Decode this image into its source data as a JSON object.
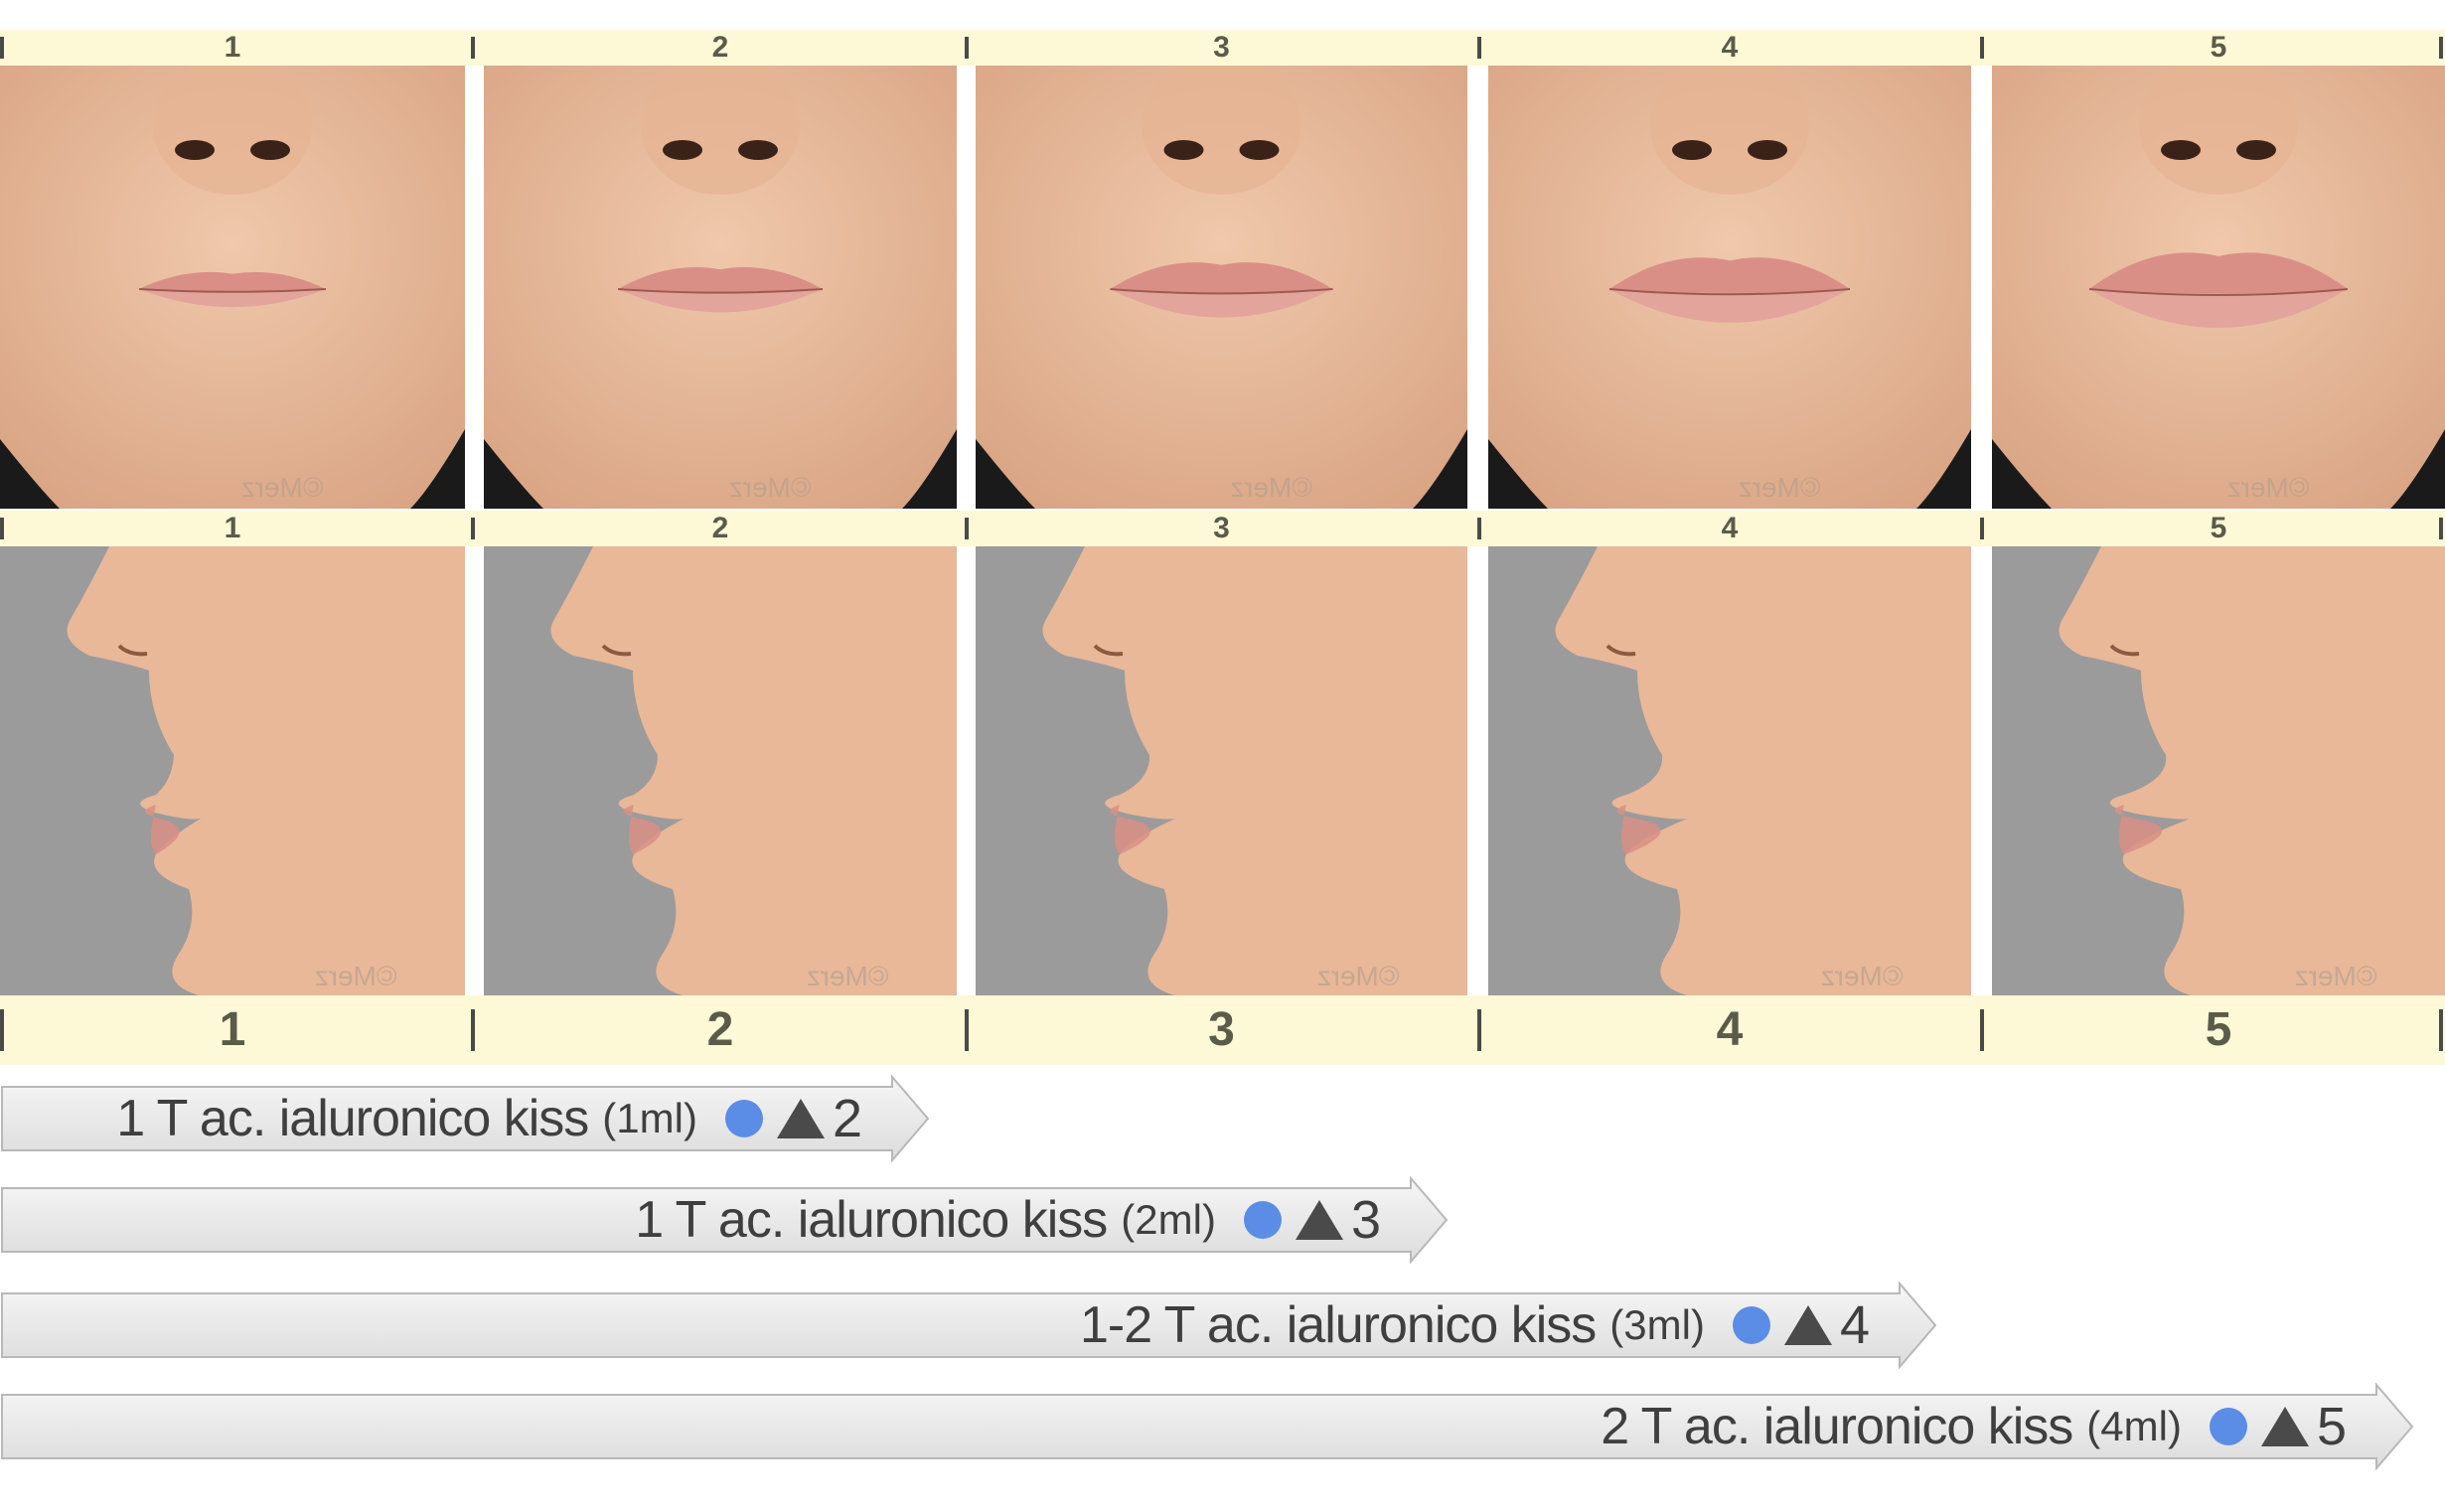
{
  "scale": {
    "top_labels": [
      "1",
      "2",
      "3",
      "4",
      "5"
    ],
    "middle_labels": [
      "1",
      "2",
      "3",
      "4",
      "5"
    ],
    "bottom_labels": [
      "1",
      "2",
      "3",
      "4",
      "5"
    ]
  },
  "photos": {
    "watermark": "©Merz",
    "front_views": [
      {
        "grade": "1",
        "lip_fullness": 0.2
      },
      {
        "grade": "2",
        "lip_fullness": 0.4
      },
      {
        "grade": "3",
        "lip_fullness": 0.6
      },
      {
        "grade": "4",
        "lip_fullness": 0.8
      },
      {
        "grade": "5",
        "lip_fullness": 1.0
      }
    ],
    "profile_views": [
      {
        "grade": "1",
        "lip_fullness": 0.2
      },
      {
        "grade": "2",
        "lip_fullness": 0.4
      },
      {
        "grade": "3",
        "lip_fullness": 0.6
      },
      {
        "grade": "4",
        "lip_fullness": 0.8
      },
      {
        "grade": "5",
        "lip_fullness": 1.0
      }
    ]
  },
  "treatments": [
    {
      "label": "1 T ac. ialuronico kiss",
      "volume": "(1ml)",
      "target": "2",
      "span_grade": "2"
    },
    {
      "label": "1 T ac. ialuronico kiss",
      "volume": "(2ml)",
      "target": "3",
      "span_grade": "3"
    },
    {
      "label": "1-2 T ac. ialuronico kiss",
      "volume": "(3ml)",
      "target": "4",
      "span_grade": "4"
    },
    {
      "label": "2 T ac. ialuronico kiss",
      "volume": "(4ml)",
      "target": "5",
      "span_grade": "5"
    }
  ],
  "colors": {
    "strip": "#fdf8d6",
    "skin": "#e8b899",
    "lips": "#d98f86",
    "profile_bg": "#9b9b9b",
    "dot": "#5b8de6",
    "arrow_fill": "#ebebeb"
  }
}
